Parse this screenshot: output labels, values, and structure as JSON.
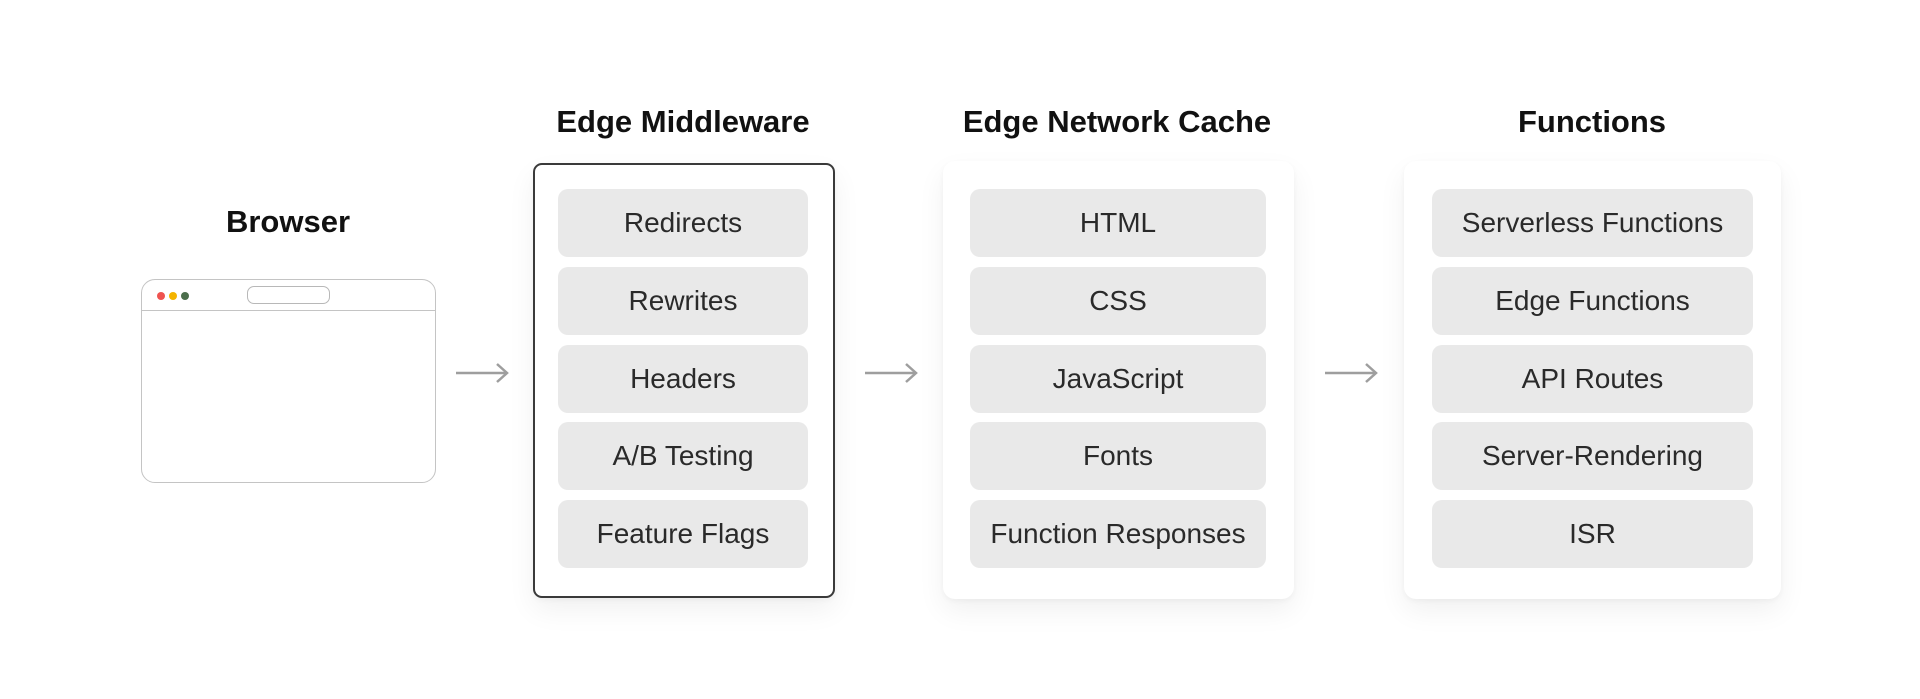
{
  "colors": {
    "dot_red": "#ef5350",
    "dot_yellow": "#f4b400",
    "dot_green": "#4c6e4c",
    "item_bg": "#e9e9e9",
    "active_border": "#3a3a3a",
    "arrow": "#9e9e9e"
  },
  "browser": {
    "title": "Browser",
    "icon": "browser-window-icon"
  },
  "stages": [
    {
      "title": "Edge Middleware",
      "active": true,
      "items": [
        "Redirects",
        "Rewrites",
        "Headers",
        "A/B Testing",
        "Feature Flags"
      ]
    },
    {
      "title": "Edge Network Cache",
      "active": false,
      "items": [
        "HTML",
        "CSS",
        "JavaScript",
        "Fonts",
        "Function Responses"
      ]
    },
    {
      "title": "Functions",
      "active": false,
      "items": [
        "Serverless Functions",
        "Edge Functions",
        "API Routes",
        "Server-Rendering",
        "ISR"
      ]
    }
  ],
  "connectors": [
    "arrow-right-icon",
    "arrow-right-icon",
    "arrow-right-icon"
  ]
}
